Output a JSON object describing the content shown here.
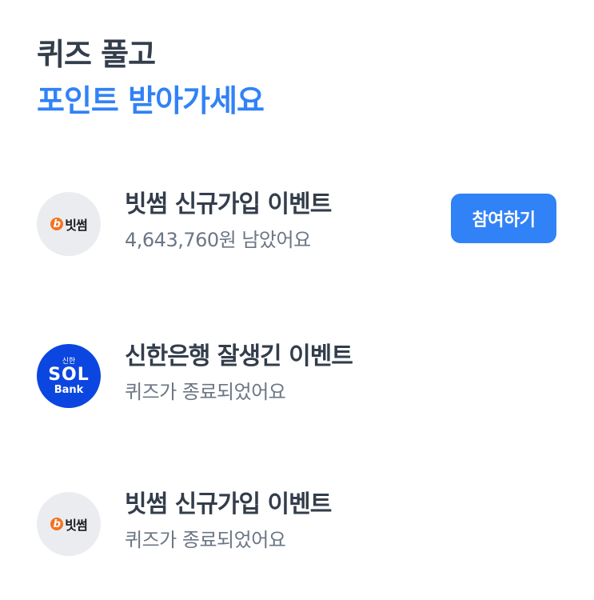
{
  "header": {
    "line1": "퀴즈 풀고",
    "line2": "포인트 받아가세요"
  },
  "items": [
    {
      "logo": {
        "kind": "bithumb",
        "mark": "b",
        "text": "빗썸"
      },
      "title": "빗썸 신규가입 이벤트",
      "subtitle": "4,643,760원 남았어요",
      "button_label": "참여하기"
    },
    {
      "logo": {
        "kind": "shinhan",
        "small": "신한",
        "main": "SOL",
        "bottom": "Bank"
      },
      "title": "신한은행 잘생긴 이벤트",
      "subtitle": "퀴즈가 종료되었어요"
    },
    {
      "logo": {
        "kind": "bithumb",
        "mark": "b",
        "text": "빗썸"
      },
      "title": "빗썸 신규가입 이벤트",
      "subtitle": "퀴즈가 종료되었어요"
    }
  ],
  "colors": {
    "accent": "#3182f6",
    "title": "#333d4b",
    "subtitle": "#6b7684",
    "shinhan_blue": "#0b46e0",
    "bithumb_orange": "#f37321"
  }
}
